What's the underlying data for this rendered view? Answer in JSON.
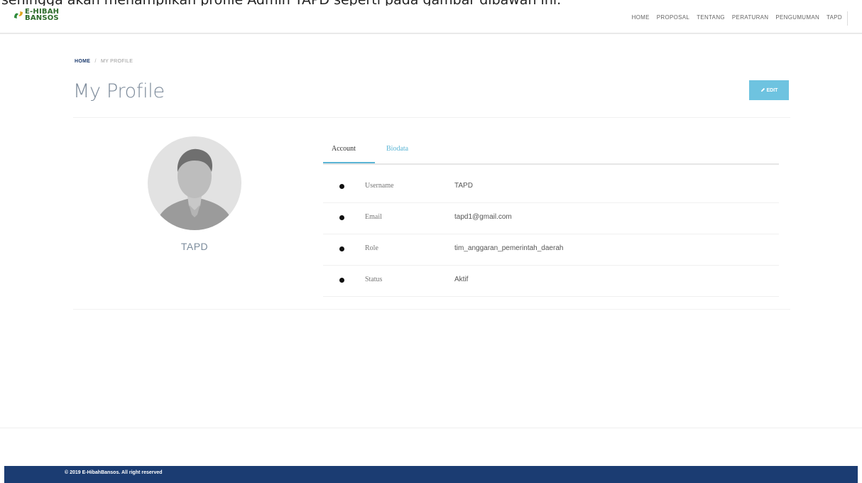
{
  "caption": "sehingga akan menampilkan profile Admin TAPD seperti pada gambar dibawah ini.",
  "brand": {
    "line1": "E-HIBAH",
    "line2": "BANSOS",
    "logo_icon": "hands-icon",
    "color": "#2d6b2a"
  },
  "nav": {
    "items": [
      "HOME",
      "PROPOSAL",
      "TENTANG",
      "PERATURAN",
      "PENGUMUMAN",
      "TAPD"
    ]
  },
  "breadcrumb": {
    "home": "HOME",
    "separator": "/",
    "current": "MY PROFILE"
  },
  "page": {
    "title": "My Profile",
    "edit_label": "EDIT",
    "edit_icon": "pencil-icon",
    "accent": "#6ec3e0"
  },
  "profile": {
    "name": "TAPD",
    "avatar_icon": "user-avatar-icon"
  },
  "tabs": [
    {
      "label": "Account",
      "active": true
    },
    {
      "label": "Biodata",
      "active": false
    }
  ],
  "account": [
    {
      "label": "Username",
      "value": "TAPD"
    },
    {
      "label": "Email",
      "value": "tapd1@gmail.com"
    },
    {
      "label": "Role",
      "value": "tim_anggaran_pemerintah_daerah"
    },
    {
      "label": "Status",
      "value": "Aktif"
    }
  ],
  "footer": {
    "text": "© 2019 E-HibahBansos. All right reserved",
    "color": "#1b3c72"
  }
}
